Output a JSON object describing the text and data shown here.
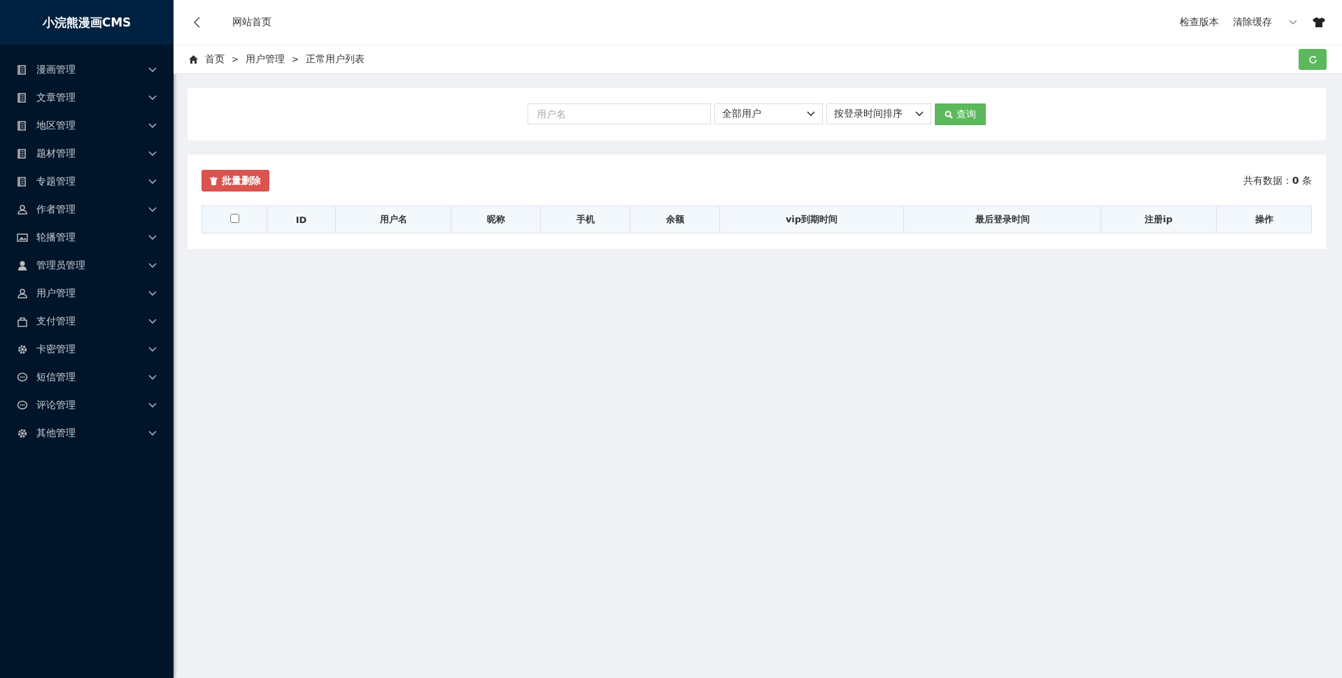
{
  "sidebar": {
    "logo": "小浣熊漫画CMS",
    "items": [
      {
        "label": "漫画管理",
        "kind": "book",
        "expanded": false
      },
      {
        "label": "文章管理",
        "kind": "book",
        "expanded": false
      },
      {
        "label": "地区管理",
        "kind": "book",
        "expanded": false
      },
      {
        "label": "题材管理",
        "kind": "book",
        "expanded": false
      },
      {
        "label": "专题管理",
        "kind": "book",
        "expanded": false
      },
      {
        "label": "作者管理",
        "kind": "person",
        "expanded": false
      },
      {
        "label": "轮播管理",
        "kind": "image",
        "expanded": false
      },
      {
        "label": "管理员管理",
        "kind": "user",
        "expanded": false
      },
      {
        "label": "用户管理",
        "kind": "person",
        "expanded": false
      },
      {
        "label": "支付管理",
        "kind": "bag",
        "expanded": false
      },
      {
        "label": "卡密管理",
        "kind": "gear",
        "expanded": false
      },
      {
        "label": "短信管理",
        "kind": "chat",
        "expanded": false
      },
      {
        "label": "评论管理",
        "kind": "chat",
        "expanded": false
      },
      {
        "label": "其他管理",
        "kind": "gear",
        "expanded": false
      }
    ]
  },
  "topbar": {
    "home_link": "网站首页",
    "actions": [
      "检查版本",
      "清除缓存"
    ]
  },
  "breadcrumb": {
    "separator": ">",
    "items": [
      "首页",
      "用户管理",
      "正常用户列表"
    ]
  },
  "filter": {
    "username": {
      "placeholder": "用户名"
    },
    "user_type": "全部用户",
    "sort": "按登录时间排序",
    "search_button": "查询"
  },
  "table_card": {
    "delete_button": "批量删除",
    "summary": "共有数据：**0** 条",
    "select_all": {
      "checked": false
    },
    "columns": [
      "ID",
      "用户名",
      "昵称",
      "手机",
      "余额",
      "vip到期时间",
      "最后登录时间",
      "注册ip",
      "操作"
    ]
  }
}
